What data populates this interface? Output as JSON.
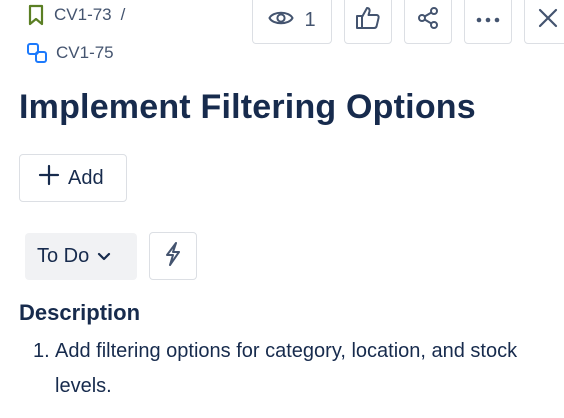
{
  "breadcrumb": {
    "parent": {
      "key": "CV1-73",
      "icon": "bookmark-icon",
      "separator": "/"
    },
    "current": {
      "key": "CV1-75",
      "icon": "subtask-icon"
    }
  },
  "toolbar": {
    "watch_icon": "eye-icon",
    "watch_count": "1",
    "like_icon": "thumbs-up-icon",
    "share_icon": "share-icon",
    "more_icon": "more-horizontal-icon",
    "close_icon": "close-icon"
  },
  "issue": {
    "title": "Implement Filtering Options",
    "add_label": "Add",
    "status_label": "To Do",
    "automation_icon": "lightning-bolt-icon"
  },
  "description": {
    "heading": "Description",
    "items": [
      {
        "number": "1.",
        "text": "Add filtering options for category, location, and stock levels."
      }
    ]
  },
  "colors": {
    "bookmark": "#5b7f24",
    "subtask": "#1d7afc",
    "text": "#172b4d",
    "muted": "#44546f",
    "border": "#dcdfe4",
    "status_bg": "#f1f2f4"
  }
}
